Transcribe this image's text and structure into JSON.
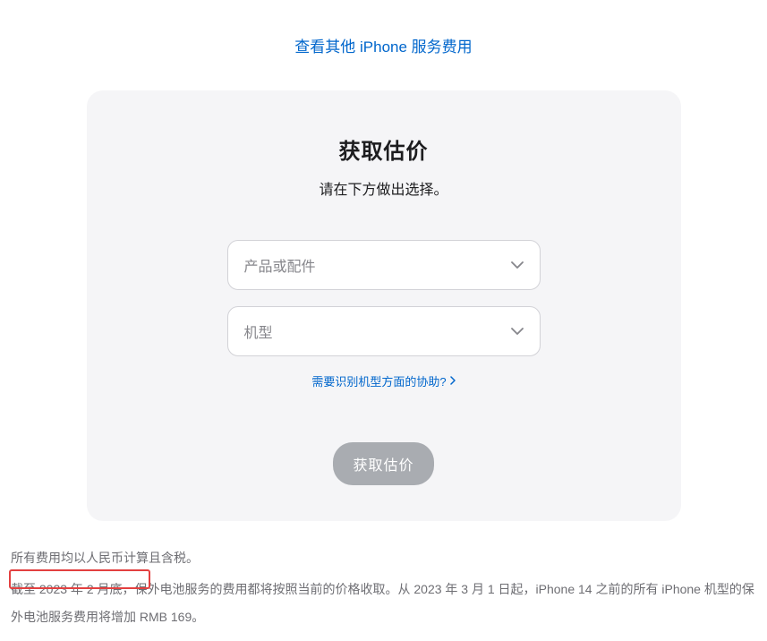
{
  "topLink": {
    "label": "查看其他 iPhone 服务费用"
  },
  "card": {
    "title": "获取估价",
    "subtitle": "请在下方做出选择。",
    "select1": {
      "placeholder": "产品或配件"
    },
    "select2": {
      "placeholder": "机型"
    },
    "helpLink": {
      "label": "需要识别机型方面的协助?"
    },
    "submit": {
      "label": "获取估价"
    }
  },
  "footer": {
    "line1": "所有费用均以人民币计算且含税。",
    "line2_part1": "截至 2023 年 2 月底，保外电池服务的费用都将按照当前的价格收取。从 2023 年 3 月 1 日起，iPhone 14 之前的所有 iPhone 机型的保外电池服务",
    "line2_part2": "费用将增加 RMB 169。"
  }
}
